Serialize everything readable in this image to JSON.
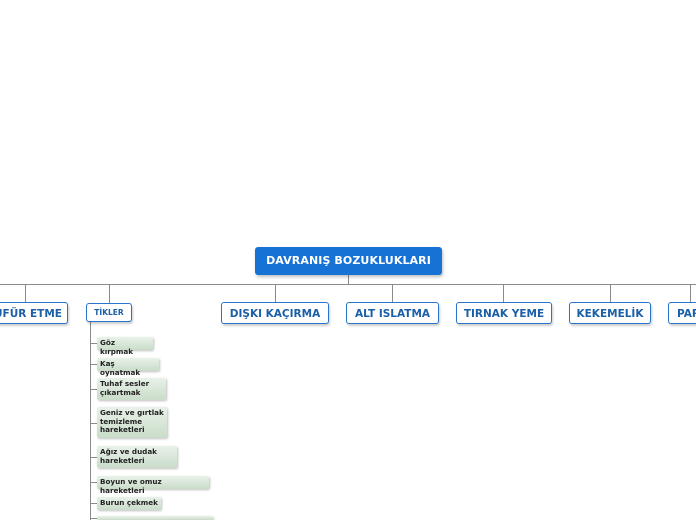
{
  "root": {
    "label": "DAVRANIŞ BOZUKLUKLARI"
  },
  "branches": [
    {
      "label": "ÜFÜR ETME"
    },
    {
      "label": "TİKLER"
    },
    {
      "label": "DIŞKI KAÇIRMA"
    },
    {
      "label": "ALT ISLATMA"
    },
    {
      "label": "TIRNAK YEME"
    },
    {
      "label": "KEKEMELİK"
    },
    {
      "label": "PAR"
    }
  ],
  "tikler_items": [
    {
      "label": "Göz kırpmak"
    },
    {
      "label": "Kaş oynatmak"
    },
    {
      "label": "Tuhaf sesler çıkartmak"
    },
    {
      "label": "Geniz ve gırtlak temizleme hareketleri"
    },
    {
      "label": "Ağız ve dudak hareketleri"
    },
    {
      "label": "Boyun ve omuz hareketleri"
    },
    {
      "label": "Burun çekmek"
    }
  ],
  "colors": {
    "root_fill": "#1772d6",
    "branch_border": "#2876cc",
    "leaf_fill": "#d7e7d7",
    "connector": "#8a8a8a"
  }
}
